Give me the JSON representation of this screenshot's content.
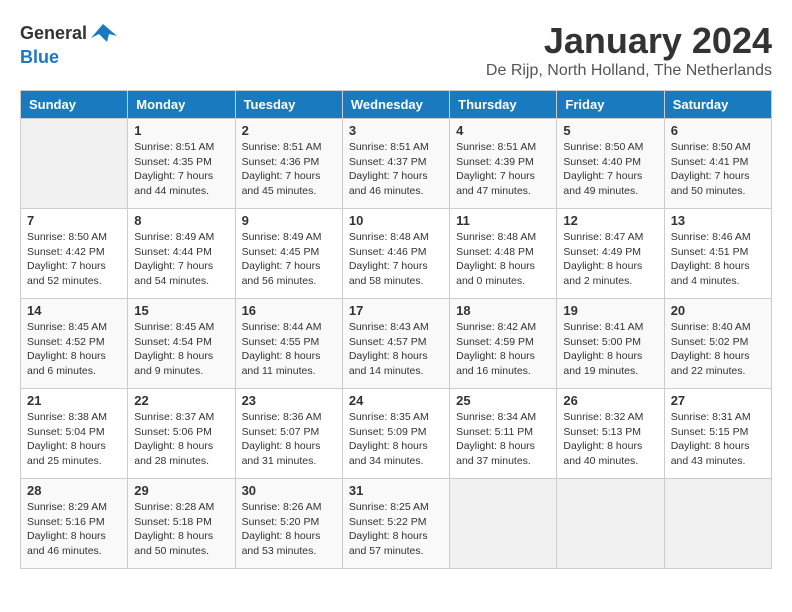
{
  "logo": {
    "text_general": "General",
    "text_blue": "Blue"
  },
  "header": {
    "month_year": "January 2024",
    "location": "De Rijp, North Holland, The Netherlands"
  },
  "days_of_week": [
    "Sunday",
    "Monday",
    "Tuesday",
    "Wednesday",
    "Thursday",
    "Friday",
    "Saturday"
  ],
  "weeks": [
    [
      {
        "day": "",
        "sunrise": "",
        "sunset": "",
        "daylight": ""
      },
      {
        "day": "1",
        "sunrise": "Sunrise: 8:51 AM",
        "sunset": "Sunset: 4:35 PM",
        "daylight": "Daylight: 7 hours and 44 minutes."
      },
      {
        "day": "2",
        "sunrise": "Sunrise: 8:51 AM",
        "sunset": "Sunset: 4:36 PM",
        "daylight": "Daylight: 7 hours and 45 minutes."
      },
      {
        "day": "3",
        "sunrise": "Sunrise: 8:51 AM",
        "sunset": "Sunset: 4:37 PM",
        "daylight": "Daylight: 7 hours and 46 minutes."
      },
      {
        "day": "4",
        "sunrise": "Sunrise: 8:51 AM",
        "sunset": "Sunset: 4:39 PM",
        "daylight": "Daylight: 7 hours and 47 minutes."
      },
      {
        "day": "5",
        "sunrise": "Sunrise: 8:50 AM",
        "sunset": "Sunset: 4:40 PM",
        "daylight": "Daylight: 7 hours and 49 minutes."
      },
      {
        "day": "6",
        "sunrise": "Sunrise: 8:50 AM",
        "sunset": "Sunset: 4:41 PM",
        "daylight": "Daylight: 7 hours and 50 minutes."
      }
    ],
    [
      {
        "day": "7",
        "sunrise": "Sunrise: 8:50 AM",
        "sunset": "Sunset: 4:42 PM",
        "daylight": "Daylight: 7 hours and 52 minutes."
      },
      {
        "day": "8",
        "sunrise": "Sunrise: 8:49 AM",
        "sunset": "Sunset: 4:44 PM",
        "daylight": "Daylight: 7 hours and 54 minutes."
      },
      {
        "day": "9",
        "sunrise": "Sunrise: 8:49 AM",
        "sunset": "Sunset: 4:45 PM",
        "daylight": "Daylight: 7 hours and 56 minutes."
      },
      {
        "day": "10",
        "sunrise": "Sunrise: 8:48 AM",
        "sunset": "Sunset: 4:46 PM",
        "daylight": "Daylight: 7 hours and 58 minutes."
      },
      {
        "day": "11",
        "sunrise": "Sunrise: 8:48 AM",
        "sunset": "Sunset: 4:48 PM",
        "daylight": "Daylight: 8 hours and 0 minutes."
      },
      {
        "day": "12",
        "sunrise": "Sunrise: 8:47 AM",
        "sunset": "Sunset: 4:49 PM",
        "daylight": "Daylight: 8 hours and 2 minutes."
      },
      {
        "day": "13",
        "sunrise": "Sunrise: 8:46 AM",
        "sunset": "Sunset: 4:51 PM",
        "daylight": "Daylight: 8 hours and 4 minutes."
      }
    ],
    [
      {
        "day": "14",
        "sunrise": "Sunrise: 8:45 AM",
        "sunset": "Sunset: 4:52 PM",
        "daylight": "Daylight: 8 hours and 6 minutes."
      },
      {
        "day": "15",
        "sunrise": "Sunrise: 8:45 AM",
        "sunset": "Sunset: 4:54 PM",
        "daylight": "Daylight: 8 hours and 9 minutes."
      },
      {
        "day": "16",
        "sunrise": "Sunrise: 8:44 AM",
        "sunset": "Sunset: 4:55 PM",
        "daylight": "Daylight: 8 hours and 11 minutes."
      },
      {
        "day": "17",
        "sunrise": "Sunrise: 8:43 AM",
        "sunset": "Sunset: 4:57 PM",
        "daylight": "Daylight: 8 hours and 14 minutes."
      },
      {
        "day": "18",
        "sunrise": "Sunrise: 8:42 AM",
        "sunset": "Sunset: 4:59 PM",
        "daylight": "Daylight: 8 hours and 16 minutes."
      },
      {
        "day": "19",
        "sunrise": "Sunrise: 8:41 AM",
        "sunset": "Sunset: 5:00 PM",
        "daylight": "Daylight: 8 hours and 19 minutes."
      },
      {
        "day": "20",
        "sunrise": "Sunrise: 8:40 AM",
        "sunset": "Sunset: 5:02 PM",
        "daylight": "Daylight: 8 hours and 22 minutes."
      }
    ],
    [
      {
        "day": "21",
        "sunrise": "Sunrise: 8:38 AM",
        "sunset": "Sunset: 5:04 PM",
        "daylight": "Daylight: 8 hours and 25 minutes."
      },
      {
        "day": "22",
        "sunrise": "Sunrise: 8:37 AM",
        "sunset": "Sunset: 5:06 PM",
        "daylight": "Daylight: 8 hours and 28 minutes."
      },
      {
        "day": "23",
        "sunrise": "Sunrise: 8:36 AM",
        "sunset": "Sunset: 5:07 PM",
        "daylight": "Daylight: 8 hours and 31 minutes."
      },
      {
        "day": "24",
        "sunrise": "Sunrise: 8:35 AM",
        "sunset": "Sunset: 5:09 PM",
        "daylight": "Daylight: 8 hours and 34 minutes."
      },
      {
        "day": "25",
        "sunrise": "Sunrise: 8:34 AM",
        "sunset": "Sunset: 5:11 PM",
        "daylight": "Daylight: 8 hours and 37 minutes."
      },
      {
        "day": "26",
        "sunrise": "Sunrise: 8:32 AM",
        "sunset": "Sunset: 5:13 PM",
        "daylight": "Daylight: 8 hours and 40 minutes."
      },
      {
        "day": "27",
        "sunrise": "Sunrise: 8:31 AM",
        "sunset": "Sunset: 5:15 PM",
        "daylight": "Daylight: 8 hours and 43 minutes."
      }
    ],
    [
      {
        "day": "28",
        "sunrise": "Sunrise: 8:29 AM",
        "sunset": "Sunset: 5:16 PM",
        "daylight": "Daylight: 8 hours and 46 minutes."
      },
      {
        "day": "29",
        "sunrise": "Sunrise: 8:28 AM",
        "sunset": "Sunset: 5:18 PM",
        "daylight": "Daylight: 8 hours and 50 minutes."
      },
      {
        "day": "30",
        "sunrise": "Sunrise: 8:26 AM",
        "sunset": "Sunset: 5:20 PM",
        "daylight": "Daylight: 8 hours and 53 minutes."
      },
      {
        "day": "31",
        "sunrise": "Sunrise: 8:25 AM",
        "sunset": "Sunset: 5:22 PM",
        "daylight": "Daylight: 8 hours and 57 minutes."
      },
      {
        "day": "",
        "sunrise": "",
        "sunset": "",
        "daylight": ""
      },
      {
        "day": "",
        "sunrise": "",
        "sunset": "",
        "daylight": ""
      },
      {
        "day": "",
        "sunrise": "",
        "sunset": "",
        "daylight": ""
      }
    ]
  ]
}
